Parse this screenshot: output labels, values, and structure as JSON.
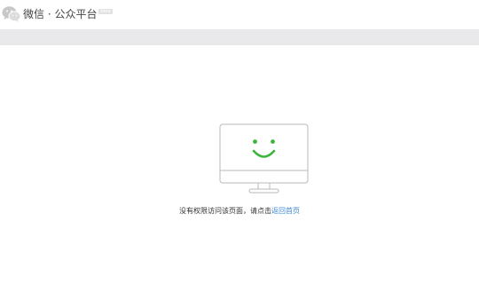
{
  "header": {
    "logo_icon": "wechat-logo-icon",
    "brand": "微信 · 公众平台",
    "badge": "beta"
  },
  "error": {
    "illustration_icon": "smiling-monitor-icon",
    "accent_color": "#3db53d",
    "message": "没有权限访问该页面，请点击",
    "link_label": "返回首页"
  }
}
